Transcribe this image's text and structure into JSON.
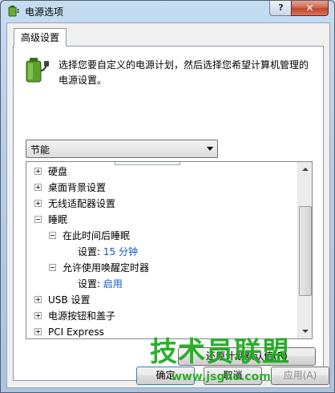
{
  "window": {
    "title": "电源选项",
    "help_label": "?",
    "close_label": "✕"
  },
  "tab": {
    "label": "高级设置"
  },
  "description": "选择您要自定义的电源计划，然后选择您希望计算机管理的电源设置。",
  "plan_select": {
    "value": "节能"
  },
  "tree": {
    "items": [
      {
        "label": "硬盘",
        "state": "collapsed"
      },
      {
        "label": "桌面背景设置",
        "state": "collapsed"
      },
      {
        "label": "无线适配器设置",
        "state": "collapsed"
      },
      {
        "label": "睡眠",
        "state": "expanded"
      },
      {
        "label": "在此时间后睡眠",
        "state": "expanded"
      },
      {
        "setting_label": "设置:",
        "value": "15 分钟"
      },
      {
        "label": "允许使用唤醒定时器",
        "state": "expanded"
      },
      {
        "setting_label": "设置:",
        "value": "启用"
      },
      {
        "label": "USB 设置",
        "state": "collapsed"
      },
      {
        "label": "电源按钮和盖子",
        "state": "collapsed"
      },
      {
        "label": "PCI Express",
        "state": "collapsed"
      }
    ]
  },
  "buttons": {
    "restore": "还原计划默认值(R)",
    "ok": "确定",
    "cancel": "取消",
    "apply": "应用(A)"
  },
  "watermark": {
    "text": "技术员联盟",
    "url": "www.jsgho.com"
  },
  "colors": {
    "value_link": "#1155cc",
    "watermark": "#1aaa1a",
    "close_button": "#c1442b"
  }
}
